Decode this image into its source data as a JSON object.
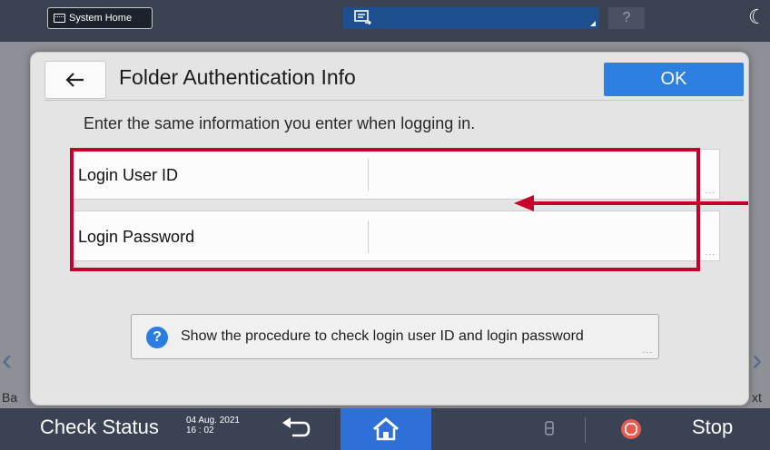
{
  "topbar": {
    "system_home_label": "System Home",
    "help_label": "?"
  },
  "background": {
    "back_label": "Ba",
    "next_label": "xt"
  },
  "modal": {
    "title": "Folder Authentication Info",
    "ok_label": "OK",
    "instruction": "Enter the same information you enter when logging in.",
    "fields": [
      {
        "label": "Login User ID",
        "value": ""
      },
      {
        "label": "Login Password",
        "value": ""
      }
    ],
    "procedure_label": "Show the procedure to check login user ID and login password",
    "more_dots": "...",
    "highlight_color": "#c5002a"
  },
  "bottombar": {
    "check_status_label": "Check Status",
    "date": "04 Aug. 2021",
    "time": "16 : 02",
    "stop_label": "Stop"
  },
  "colors": {
    "accent": "#2e7fe2",
    "topbar": "#3a4150",
    "home": "#2e6fd8",
    "stop": "#e85a4e"
  }
}
